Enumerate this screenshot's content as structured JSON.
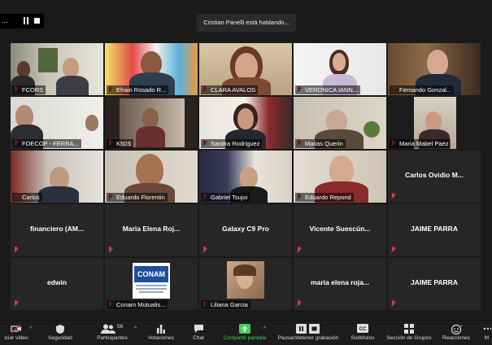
{
  "top": {
    "speaker_text": "Cristian Panelli está hablando...",
    "dots": "..."
  },
  "tiles": [
    {
      "name": "FCORS"
    },
    {
      "name": "Efrain Rosado R..."
    },
    {
      "name": "CLARA AVALOS"
    },
    {
      "name": "VERONICA IANN..."
    },
    {
      "name": "Fernando Gonzal..."
    },
    {
      "name": "FOECOP - FERRA..."
    },
    {
      "name": "K50S"
    },
    {
      "name": "Sandra Rodriguez"
    },
    {
      "name": "Matias Querin"
    },
    {
      "name": "Maria Mabel Paez"
    },
    {
      "name": "Carlos"
    },
    {
      "name": "Eduardo Florentin"
    },
    {
      "name": "Gabriel Tsujoi"
    },
    {
      "name": "Eduardo Repond"
    },
    {
      "name": "Carlos Ovidio M..."
    },
    {
      "name": "financiero (AM..."
    },
    {
      "name": "Maria Elena Roj..."
    },
    {
      "name": "Galaxy C9 Pro"
    },
    {
      "name": "Vicente Suescún..."
    },
    {
      "name": "JAIME PARRA"
    },
    {
      "name": "edwin"
    },
    {
      "name": "Conam Mutualis..."
    },
    {
      "name": "Liliana Garcia"
    },
    {
      "name": "maria elena roja..."
    },
    {
      "name": "JAIME PARRA"
    }
  ],
  "conam_logo_text": "CONAM",
  "toolbar": {
    "start_video": "iciar video",
    "security": "Seguridad",
    "participants": "Participantes",
    "participants_count": "56",
    "polls": "Votaciones",
    "chat": "Chat",
    "share": "Compartir pantalla",
    "record": "Pausar/detener grabación",
    "subtitles": "Subtítulos",
    "breakout": "Sección de Grupos",
    "reactions": "Reacciones",
    "more": "M"
  },
  "colors": {
    "mute_red": "#e0364a",
    "share_green": "#3fd15a",
    "bg": "#1a1a1a"
  }
}
